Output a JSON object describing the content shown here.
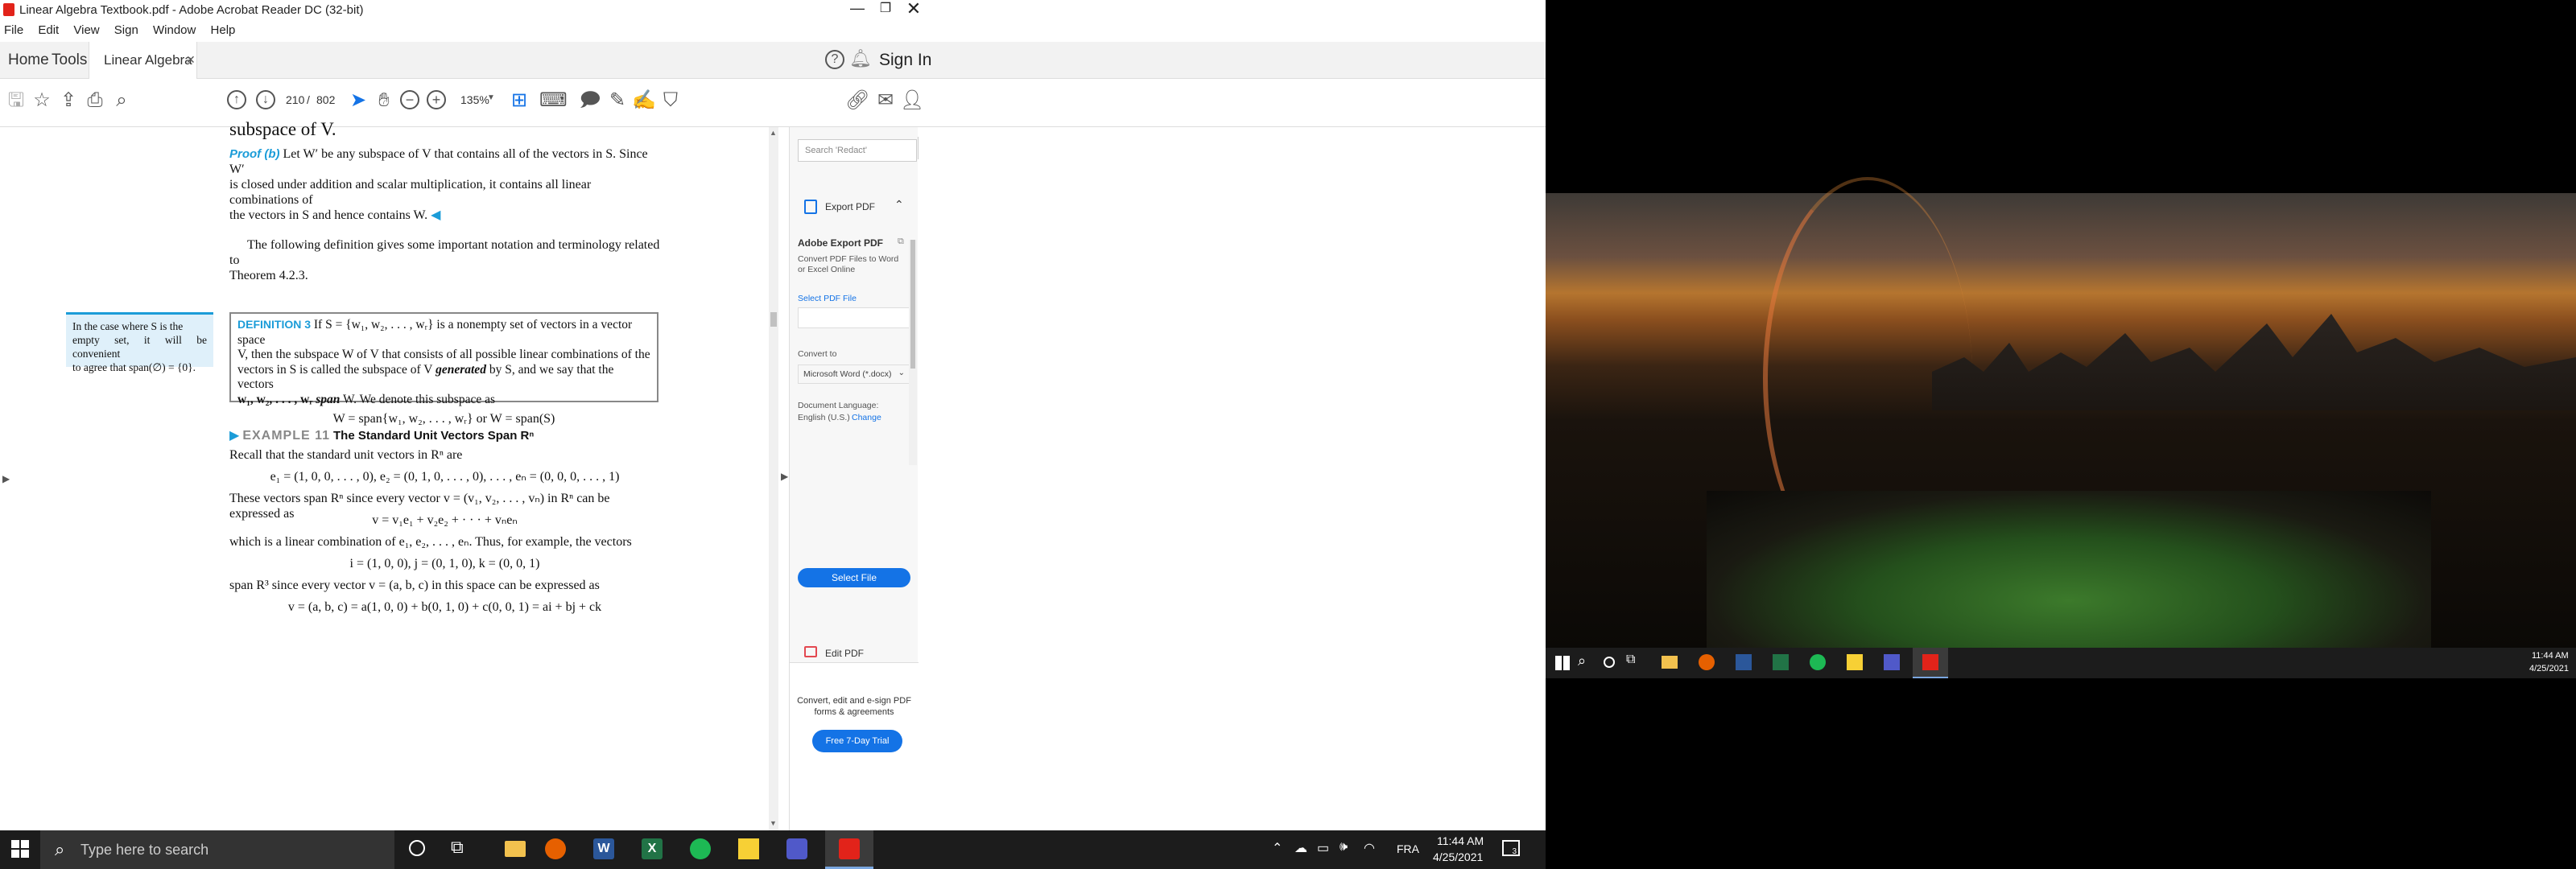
{
  "window": {
    "title": "Linear Algebra Textbook.pdf - Adobe Acrobat Reader DC (32-bit)"
  },
  "menu": [
    "File",
    "Edit",
    "View",
    "Sign",
    "Window",
    "Help"
  ],
  "tabs": {
    "home": "Home",
    "tools": "Tools",
    "doc": "Linear Algebra Text...",
    "signin": "Sign In"
  },
  "toolbar": {
    "page_current": "210",
    "page_sep": "/",
    "page_total": "802",
    "zoom": "135%"
  },
  "doc": {
    "line1": "subspace of V.",
    "proof_label": "Proof (b)",
    "proof_text1": "Let W′ be any subspace of V that contains all of the vectors in S. Since W′",
    "proof_text2": "is closed under addition and scalar multiplication, it contains all linear combinations of",
    "proof_text3": "the vectors in S and hence contains W.",
    "para1a": "The following definition gives some important notation and terminology related to",
    "para1b": "Theorem 4.2.3.",
    "side_note1": "In the case where S is the",
    "side_note2": "empty set, it will be convenient",
    "side_note3": "to agree that span(∅) = {0}.",
    "def_label": "DEFINITION 3",
    "def1": "If S = {w₁, w₂, . . . , wᵣ} is a nonempty set of vectors in a vector space",
    "def2": "V, then the subspace W of V that consists of all possible linear combinations of the",
    "def3a": "vectors in S is called the subspace of V",
    "def3b": "generated",
    "def3c": "by S, and we say that the vectors",
    "def4a": "w₁, w₂, . . . , wᵣ",
    "def4b": "span",
    "def4c": "W. We denote this subspace as",
    "def_eq": "W = span{w₁, w₂, . . . , wᵣ}   or   W = span(S)",
    "ex_label": "EXAMPLE 11",
    "ex_title": "The Standard Unit Vectors Span Rⁿ",
    "ex1": "Recall that the standard unit vectors in Rⁿ are",
    "ex_eq1": "e₁ = (1, 0, 0, . . . , 0),   e₂ = (0, 1, 0, . . . , 0), . . . ,   eₙ = (0, 0, 0, . . . , 1)",
    "ex2": "These vectors span Rⁿ since every vector v = (v₁, v₂, . . . , vₙ) in Rⁿ can be expressed as",
    "ex_eq2": "v = v₁e₁ + v₂e₂ + · · · + vₙeₙ",
    "ex3": "which is a linear combination of e₁, e₂, . . . , eₙ. Thus, for example, the vectors",
    "ex_eq3": "i = (1, 0, 0),   j = (0, 1, 0),   k = (0, 0, 1)",
    "ex4": "span R³ since every vector v = (a, b, c) in this space can be expressed as",
    "ex_eq4": "v = (a, b, c) = a(1, 0, 0) + b(0, 1, 0) + c(0, 0, 1) = ai + bj + ck"
  },
  "panel": {
    "search_placeholder": "Search 'Redact'",
    "export_title": "Export PDF",
    "adobe_export": "Adobe Export PDF",
    "convert_desc1": "Convert PDF Files to Word",
    "convert_desc2": "or Excel Online",
    "select_pdf_link": "Select PDF File",
    "convert_to": "Convert to",
    "format": "Microsoft Word (*.docx)",
    "doc_lang": "Document Language:",
    "lang": "English (U.S.)",
    "change": "Change",
    "select_file": "Select File",
    "edit_pdf": "Edit PDF",
    "promo1": "Convert, edit and e-sign PDF",
    "promo2": "forms & agreements",
    "trial": "Free 7-Day Trial"
  },
  "taskbar": {
    "search": "Type here to search",
    "lang": "FRA",
    "time": "11:44 AM",
    "date": "4/25/2021",
    "notif": "3"
  },
  "taskbar2": {
    "time": "11:44 AM",
    "date": "4/25/2021"
  }
}
